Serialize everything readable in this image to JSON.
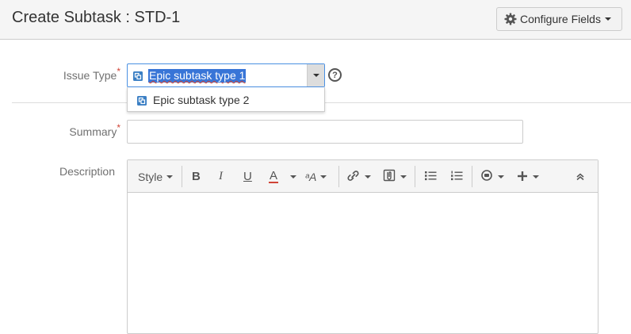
{
  "header": {
    "title": "Create Subtask : STD-1",
    "configure_fields_label": "Configure Fields"
  },
  "form": {
    "issue_type": {
      "label": "Issue Type",
      "required_mark": "*",
      "selected_value": "Epic subtask type 1",
      "options": [
        {
          "label": "Epic subtask type 2",
          "icon": "subtask-icon"
        }
      ],
      "help_glyph": "?"
    },
    "summary": {
      "label": "Summary",
      "required_mark": "*",
      "value": ""
    },
    "description": {
      "label": "Description",
      "toolbar": {
        "style_label": "Style",
        "bold_glyph": "B",
        "italic_glyph": "I",
        "underline_glyph": "U",
        "text_color_glyph": "A",
        "text_size_glyph": "ᵃA"
      }
    }
  },
  "colors": {
    "focus_border": "#4a90e2",
    "selection_bg": "#3875d7",
    "required": "#d04437",
    "text_color_underline": "#d04437",
    "issue_icon": "#3b7fc4"
  }
}
